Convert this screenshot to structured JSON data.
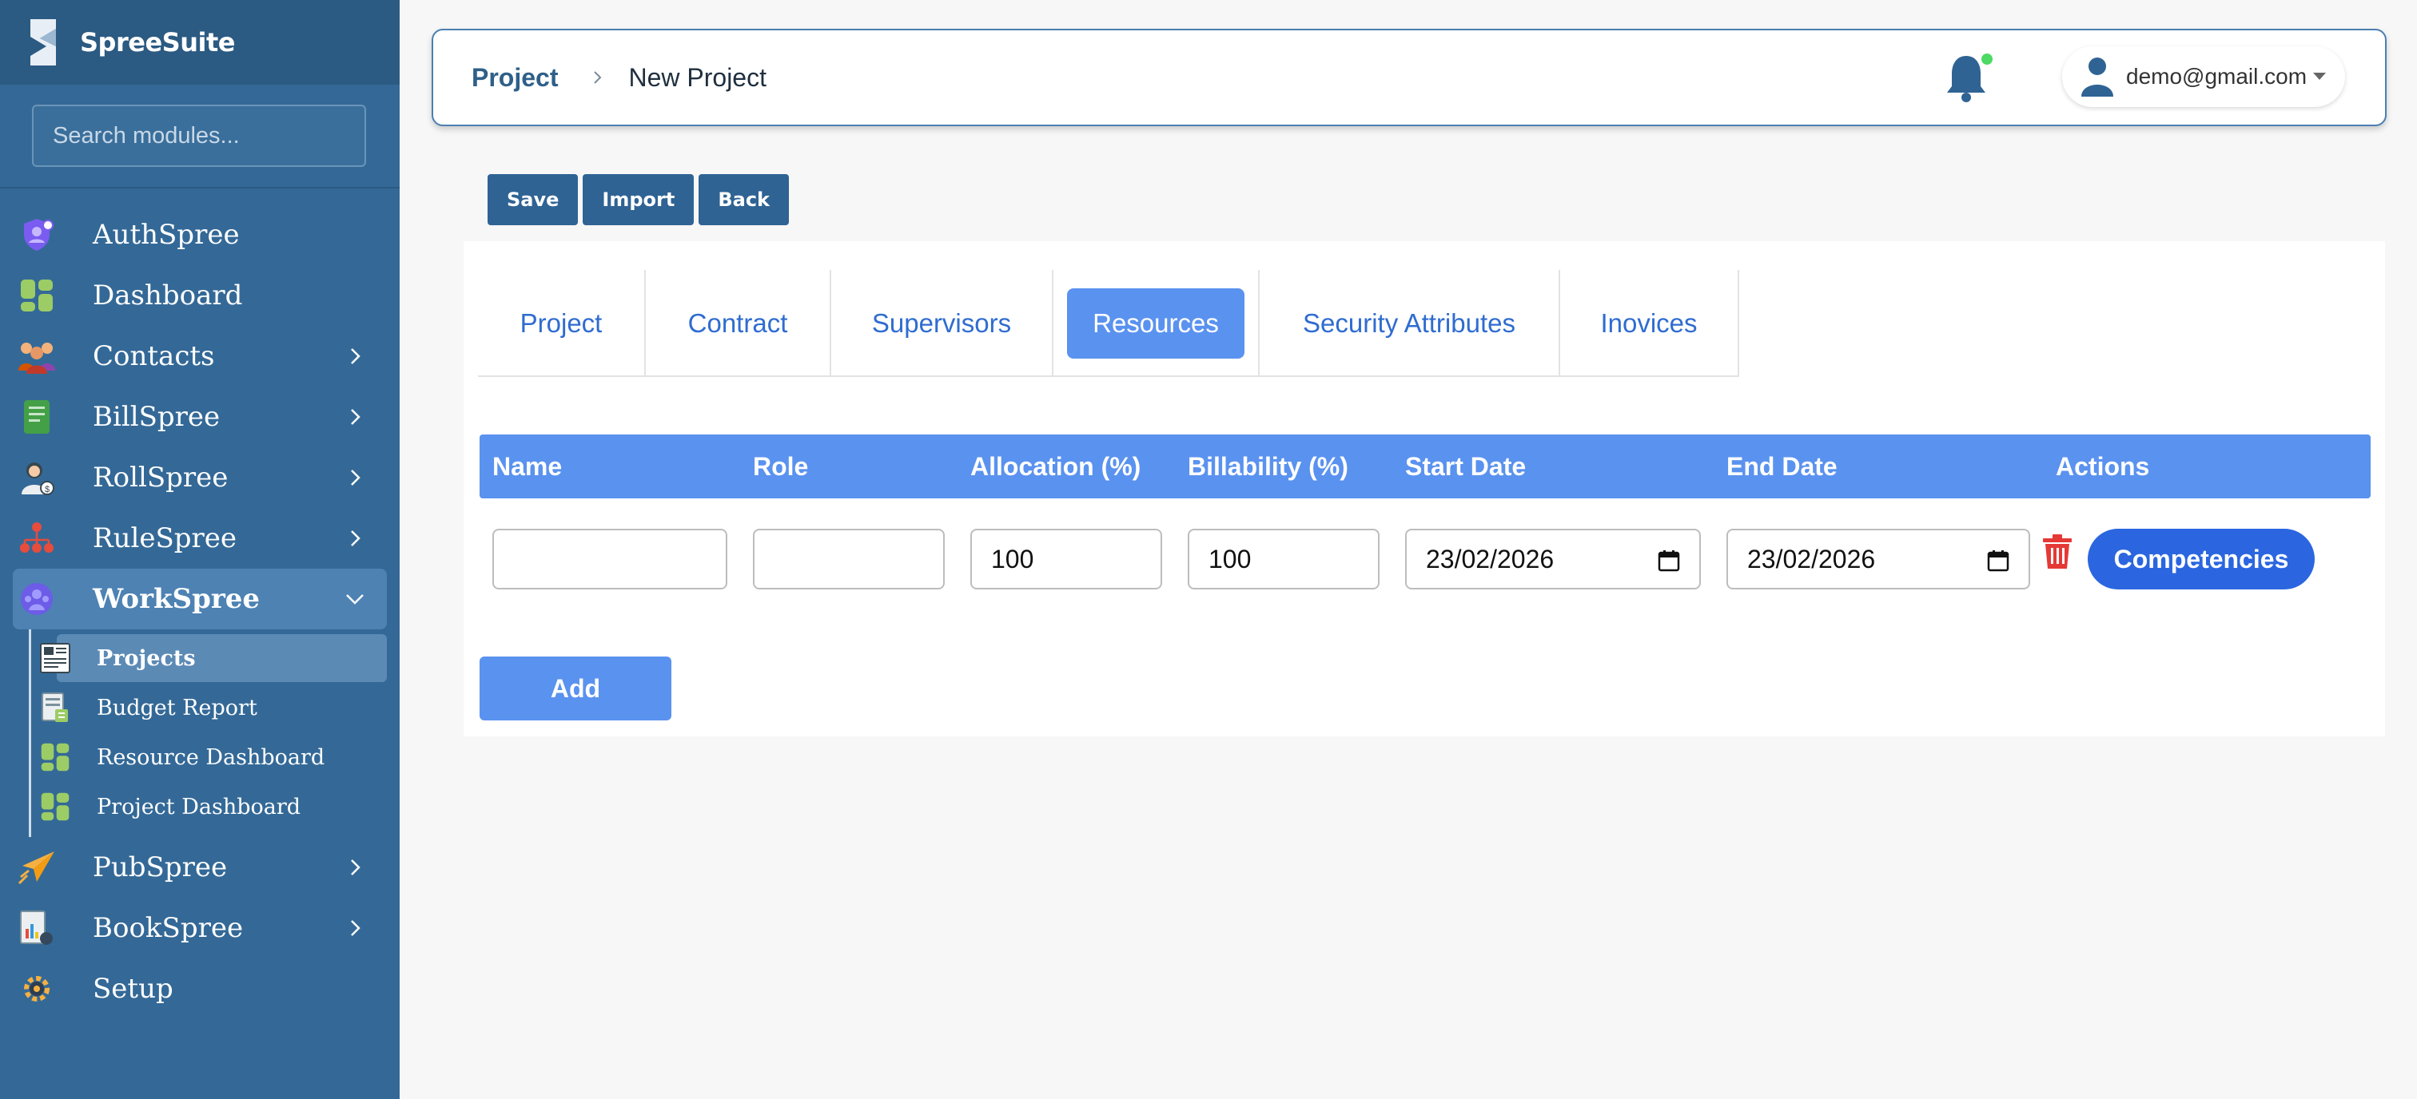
{
  "brand": {
    "name": "SpreeSuite"
  },
  "search": {
    "placeholder": "Search modules..."
  },
  "sidebar": {
    "items": [
      {
        "label": "AuthSpree",
        "icon": "shield-user-icon",
        "has_children": false
      },
      {
        "label": "Dashboard",
        "icon": "dashboard-grid-icon",
        "has_children": false
      },
      {
        "label": "Contacts",
        "icon": "people-group-icon",
        "has_children": true
      },
      {
        "label": "BillSpree",
        "icon": "invoice-icon",
        "has_children": true
      },
      {
        "label": "RollSpree",
        "icon": "payroll-user-icon",
        "has_children": true
      },
      {
        "label": "RuleSpree",
        "icon": "org-hierarchy-icon",
        "has_children": true
      },
      {
        "label": "WorkSpree",
        "icon": "workgroup-icon",
        "has_children": true,
        "expanded": true
      },
      {
        "label": "PubSpree",
        "icon": "paper-plane-icon",
        "has_children": true
      },
      {
        "label": "BookSpree",
        "icon": "ledger-report-icon",
        "has_children": true
      },
      {
        "label": "Setup",
        "icon": "gear-icon",
        "has_children": false
      }
    ],
    "workspree_children": [
      {
        "label": "Projects",
        "icon": "project-board-icon",
        "active": true
      },
      {
        "label": "Budget Report",
        "icon": "budget-sheet-icon",
        "active": false
      },
      {
        "label": "Resource Dashboard",
        "icon": "dashboard-grid-icon",
        "active": false
      },
      {
        "label": "Project Dashboard",
        "icon": "dashboard-grid-icon",
        "active": false
      }
    ]
  },
  "header": {
    "breadcrumb_root": "Project",
    "breadcrumb_current": "New Project",
    "user_email": "demo@gmail.com",
    "notification_status_color": "#4cd964"
  },
  "toolbar": {
    "save_label": "Save",
    "import_label": "Import",
    "back_label": "Back"
  },
  "tabs": [
    {
      "label": "Project",
      "active": false
    },
    {
      "label": "Contract",
      "active": false
    },
    {
      "label": "Supervisors",
      "active": false
    },
    {
      "label": "Resources",
      "active": true
    },
    {
      "label": "Security Attributes",
      "active": false
    },
    {
      "label": "Inovices",
      "active": false
    }
  ],
  "resources_table": {
    "columns": [
      "Name",
      "Role",
      "Allocation (%)",
      "Billability (%)",
      "Start Date",
      "End Date",
      "Actions"
    ],
    "rows": [
      {
        "name": "",
        "role": "",
        "allocation": "100",
        "billability": "100",
        "start_date": "23/02/2026",
        "end_date": "23/02/2026",
        "competencies_label": "Competencies"
      }
    ],
    "add_label": "Add"
  },
  "colors": {
    "sidebar_bg": "#346997",
    "accent": "#5a92ef",
    "primary_button": "#2f6394",
    "competencies_button": "#2b66e0",
    "delete_icon": "#e53935"
  }
}
